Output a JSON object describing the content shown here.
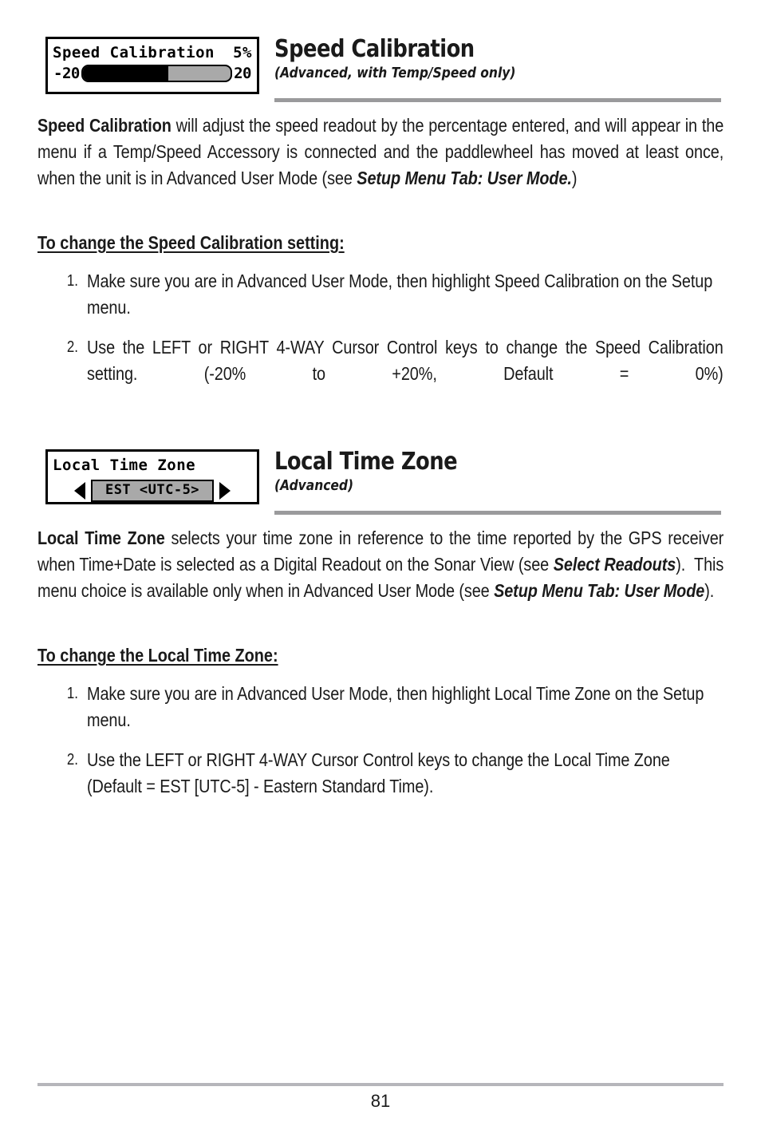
{
  "page": {
    "number": "81"
  },
  "sections": [
    {
      "id": "speed",
      "title": "Speed Calibration",
      "subtitle": "(Advanced, with Temp/Speed only)",
      "widget": {
        "type": "slider",
        "label": "Speed Calibration",
        "value": "5%",
        "min_label": "-20",
        "max_label": "20",
        "fill_percent": 58
      },
      "intro_html": "<b>Speed Calibration</b> will adjust the speed readout by the percentage entered, and will appear in the menu if a Temp/Speed Accessory is connected and the paddlewheel has moved at least once, when the unit is in Advanced User Mode (see <b class=\"bi\">Setup Menu Tab: User Mode.</b>)",
      "subhead": "To change the Speed Calibration setting:",
      "steps": [
        {
          "num": "1.",
          "text": "Make sure you are in Advanced User Mode, then highlight Speed Calibration on the Setup menu.",
          "justified": false
        },
        {
          "num": "2.",
          "text": "Use the LEFT or RIGHT 4-WAY Cursor Control keys to change the Speed Calibration setting. (-20% to +20%, Default = 0%)",
          "justified": true
        }
      ]
    },
    {
      "id": "tz",
      "title": "Local Time Zone",
      "subtitle": "(Advanced)",
      "widget": {
        "type": "select",
        "label": "Local Time Zone",
        "value": "EST <UTC-5>",
        "left_arrow": "prev-arrow-icon",
        "right_arrow": "next-arrow-icon"
      },
      "intro_html": "<b>Local Time Zone</b> selects your time zone in reference to the time reported by the GPS receiver when Time+Date is selected as a Digital Readout on the Sonar View (see <b class=\"bi\">Select Readouts</b>).&nbsp; This menu choice is available only when in Advanced User Mode (see <b class=\"bi\">Setup Menu Tab: User Mode</b>).",
      "subhead": "To change the Local Time Zone:",
      "steps": [
        {
          "num": "1.",
          "text": "Make sure you are in Advanced User Mode, then highlight Local Time Zone on the Setup menu.",
          "justified": false
        },
        {
          "num": "2.",
          "text": "Use the LEFT or RIGHT 4-WAY Cursor Control keys to change the Local Time Zone (Default = EST [UTC-5] - Eastern Standard Time).",
          "justified": false
        }
      ]
    }
  ],
  "colors": {
    "rule": "#9a9a9c",
    "footer_rule": "#b6b6bb",
    "lcd_grey": "#a9a9a9",
    "lcd_black": "#000000",
    "text": "#1a1a1a"
  }
}
